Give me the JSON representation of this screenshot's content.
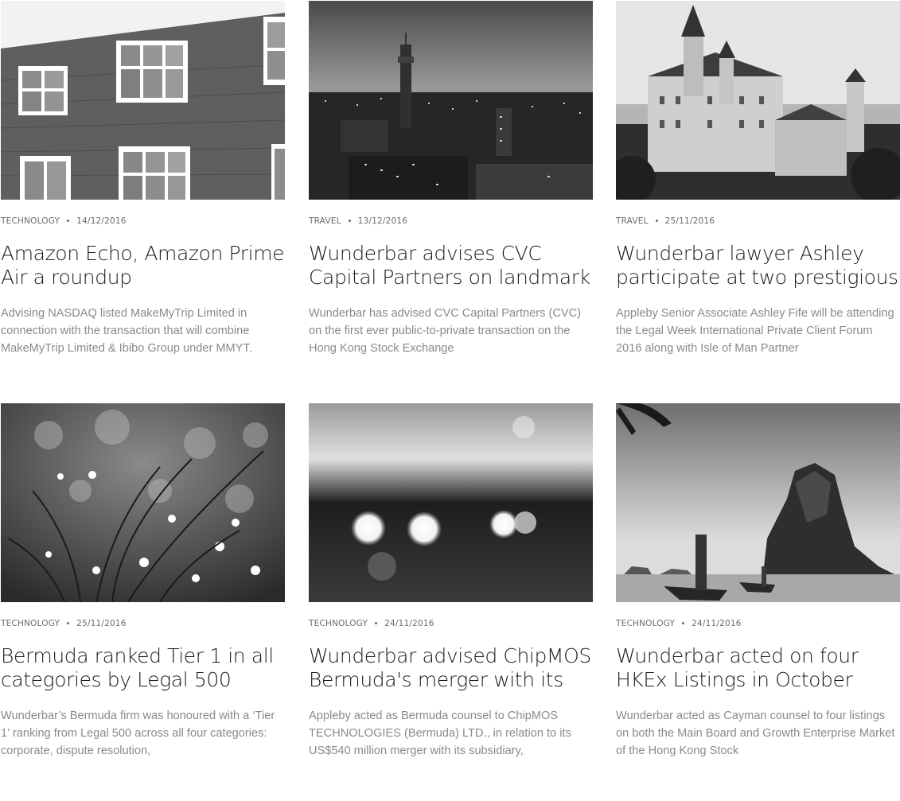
{
  "posts": [
    {
      "category": "TECHNOLOGY",
      "date": "14/12/2016",
      "title": "Amazon Echo, Amazon Prime Air a roundup",
      "excerpt": "Advising NASDAQ listed MakeMyTrip Limited in connection with the transaction that will combine MakeMyTrip Limited & Ibibo Group under MMYT.",
      "image": "brick-building-windows-photo"
    },
    {
      "category": "TRAVEL",
      "date": "13/12/2016",
      "title": "Wunderbar advises CVC Capital Partners on landmark Hong",
      "excerpt": "Wunderbar has advised CVC Capital Partners (CVC) on the first ever public-to-private transaction on the Hong Kong Stock Exchange",
      "image": "city-skyline-tower-photo"
    },
    {
      "category": "TRAVEL",
      "date": "25/11/2016",
      "title": "Wunderbar lawyer Ashley participate at two prestigious",
      "excerpt": "Appleby Senior Associate Ashley Fife will be attending the Legal Week International Private Client Forum 2016 along with Isle of Man Partner",
      "image": "castle-photo"
    },
    {
      "category": "TECHNOLOGY",
      "date": "25/11/2016",
      "title": "Bermuda ranked Tier 1 in all categories by Legal 500",
      "excerpt": "Wunderbar’s Bermuda firm was honoured with a ‘Tier 1’ ranking from Legal 500 across all four categories: corporate, dispute resolution,",
      "image": "dewy-grass-bokeh-photo"
    },
    {
      "category": "TECHNOLOGY",
      "date": "24/11/2016",
      "title": "Wunderbar advised ChipMOS Bermuda's merger with its",
      "excerpt": "Appleby acted as Bermuda counsel to ChipMOS TECHNOLOGIES (Bermuda) LTD., in relation to its US$540 million merger with its subsidiary,",
      "image": "blurred-lights-photo"
    },
    {
      "category": "TECHNOLOGY",
      "date": "24/11/2016",
      "title": "Wunderbar acted on four HKEx Listings in October",
      "excerpt": "Wunderbar acted as Cayman counsel to four listings on both the Main Board and Growth Enterprise Market of the Hong Kong Stock",
      "image": "sea-rock-boats-photo"
    }
  ]
}
